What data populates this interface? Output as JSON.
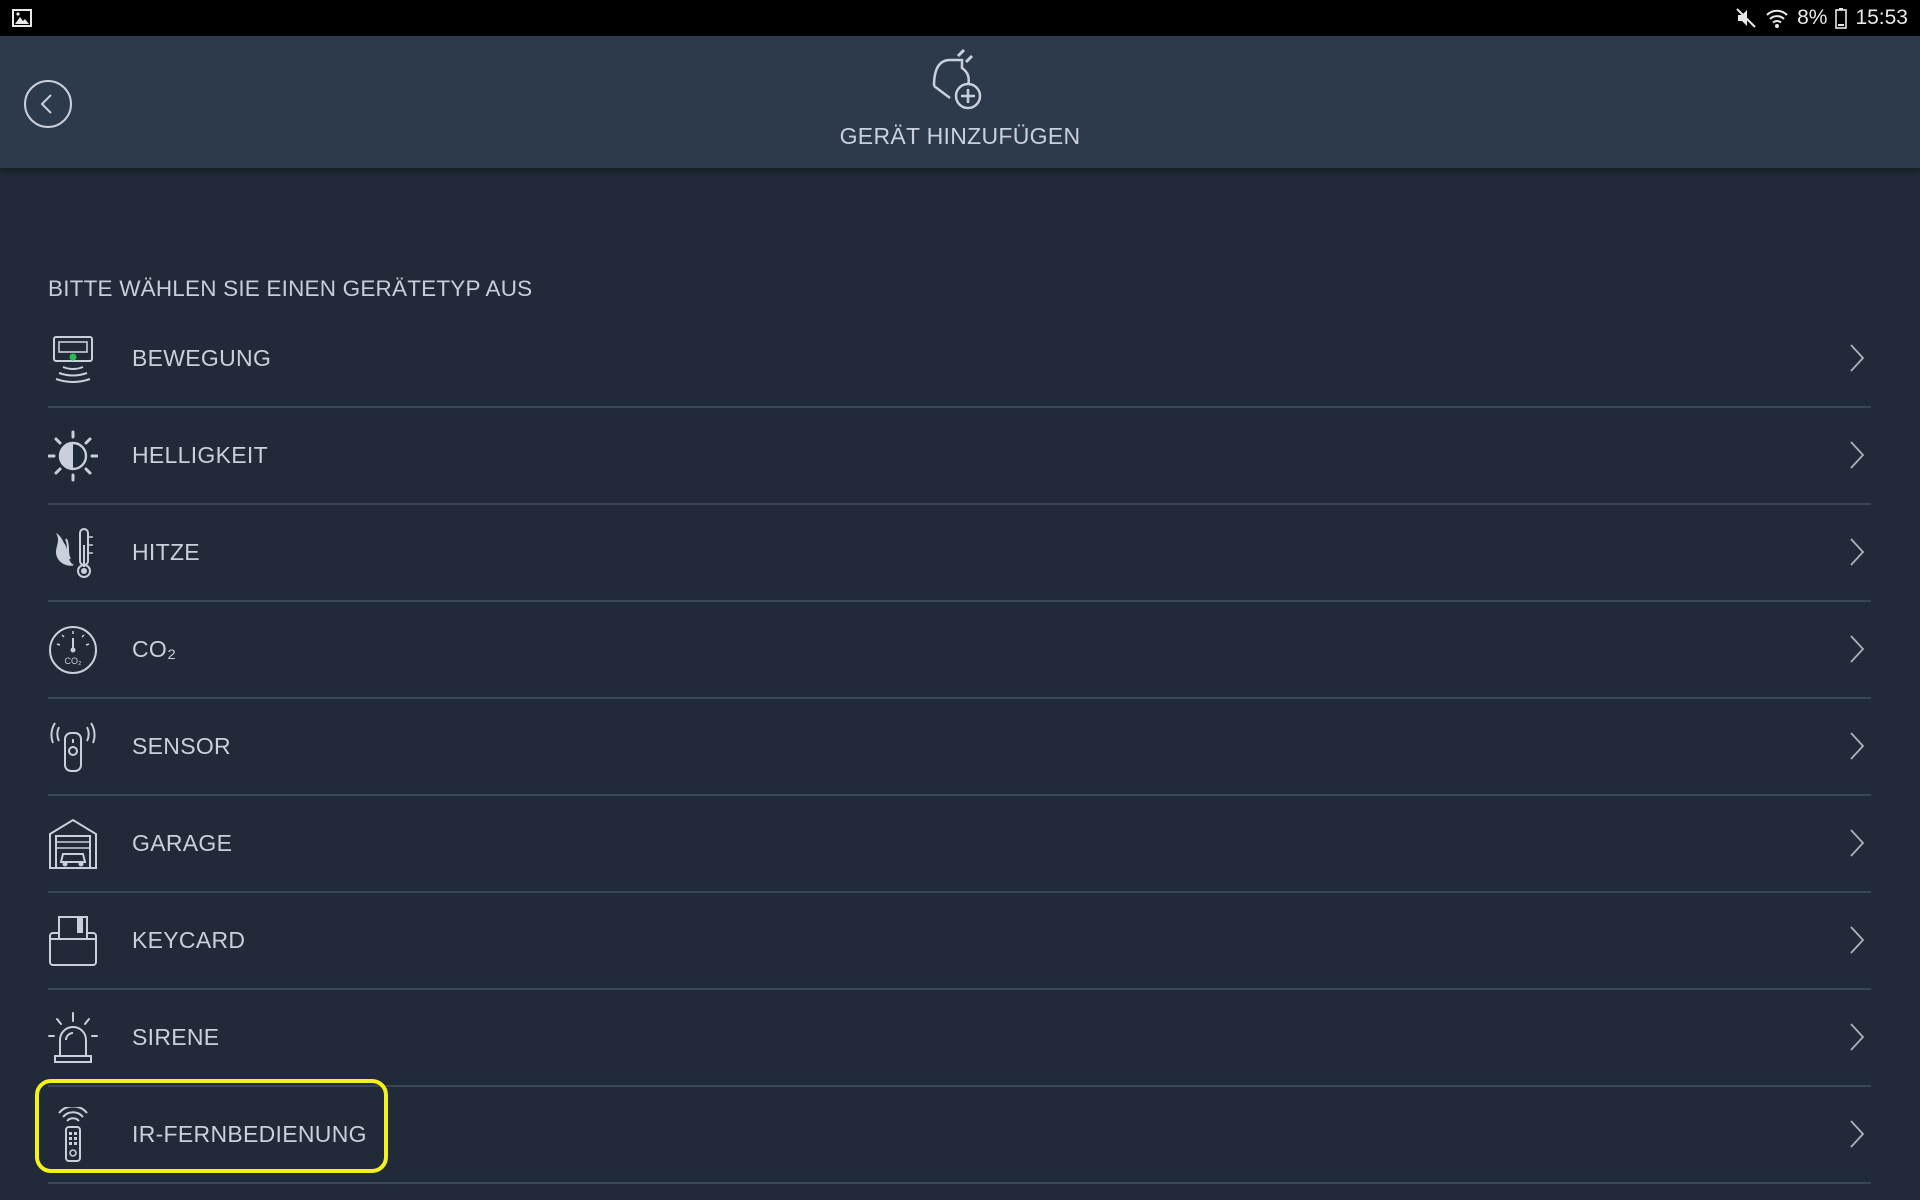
{
  "status_bar": {
    "left_icon": "image-notification-icon",
    "battery_percent": "8%",
    "time": "15:53",
    "icons": [
      "mute-icon",
      "wifi-icon",
      "battery-icon"
    ]
  },
  "header": {
    "back_icon": "back-arrow-icon",
    "icon": "plug-add-icon",
    "title": "GERÄT HINZUFÜGEN"
  },
  "prompt": "BITTE WÄHLEN SIE EINEN GERÄTETYP AUS",
  "device_types": [
    {
      "label": "BEWEGUNG",
      "icon": "motion-sensor-icon"
    },
    {
      "label": "HELLIGKEIT",
      "icon": "brightness-icon"
    },
    {
      "label": "HITZE",
      "icon": "heat-thermometer-icon"
    },
    {
      "label": "CO₂",
      "icon": "co2-gauge-icon"
    },
    {
      "label": "SENSOR",
      "icon": "sensor-icon"
    },
    {
      "label": "GARAGE",
      "icon": "garage-icon"
    },
    {
      "label": "KEYCARD",
      "icon": "keycard-icon"
    },
    {
      "label": "SIRENE",
      "icon": "siren-icon"
    },
    {
      "label": "IR-FERNBEDIENUNG",
      "icon": "ir-remote-icon"
    }
  ],
  "colors": {
    "background": "#212a38",
    "header": "#2d3a4c",
    "divider": "#3a4556",
    "text": "#c9d0db",
    "highlight": "#f2f21a"
  }
}
